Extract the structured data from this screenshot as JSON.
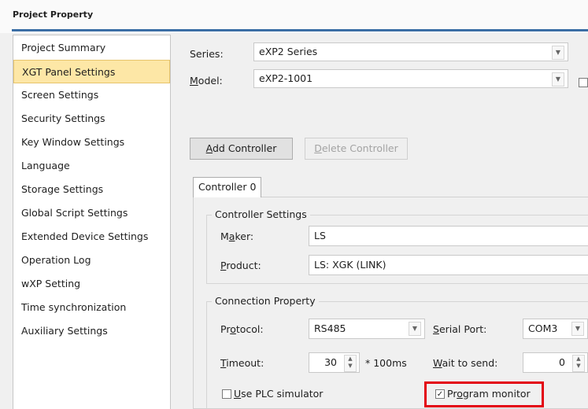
{
  "window": {
    "title": "Project Property"
  },
  "sidebar": {
    "items": [
      {
        "label": "Project Summary"
      },
      {
        "label": "XGT Panel Settings"
      },
      {
        "label": "Screen Settings"
      },
      {
        "label": "Security Settings"
      },
      {
        "label": "Key Window Settings"
      },
      {
        "label": "Language"
      },
      {
        "label": "Storage Settings"
      },
      {
        "label": "Global Script Settings"
      },
      {
        "label": "Extended Device Settings"
      },
      {
        "label": "Operation Log"
      },
      {
        "label": "wXP Setting"
      },
      {
        "label": "Time synchronization"
      },
      {
        "label": "Auxiliary Settings"
      }
    ],
    "selected": "XGT Panel Settings"
  },
  "panel": {
    "series_label": "Series:",
    "series_value": "eXP2 Series",
    "model_label_pre": "",
    "model_label_u": "M",
    "model_label_post": "odel:",
    "model_value": "eXP2-1001",
    "add_controller_u": "A",
    "add_controller_rest": "dd Controller",
    "delete_controller_u": "D",
    "delete_controller_rest": "elete Controller",
    "tab_label": "Controller 0",
    "controller_settings": {
      "legend": "Controller Settings",
      "maker_pre": "M",
      "maker_u": "a",
      "maker_post": "ker:",
      "maker_value": "LS",
      "product_u": "P",
      "product_post": "roduct:",
      "product_value": "LS: XGK (LINK)"
    },
    "connection": {
      "legend": "Connection Property",
      "protocol_pre": "Pr",
      "protocol_u": "o",
      "protocol_post": "tocol:",
      "protocol_value": "RS485",
      "serial_u": "S",
      "serial_post": "erial Port:",
      "serial_value": "COM3",
      "timeout_u": "T",
      "timeout_post": "imeout:",
      "timeout_value": "30",
      "timeout_unit": "* 100ms",
      "wait_u": "W",
      "wait_post": "ait to send:",
      "wait_value": "0",
      "use_plc_u": "U",
      "use_plc_post": "se PLC simulator",
      "use_plc_checked": false,
      "program_monitor_pre": "Pr",
      "program_monitor_u": "o",
      "program_monitor_post": "gram monitor",
      "program_monitor_checked": true
    }
  },
  "colors": {
    "highlight": "#e3000f",
    "selection": "#fde7a6",
    "accent_line": "#3b6ea5"
  }
}
